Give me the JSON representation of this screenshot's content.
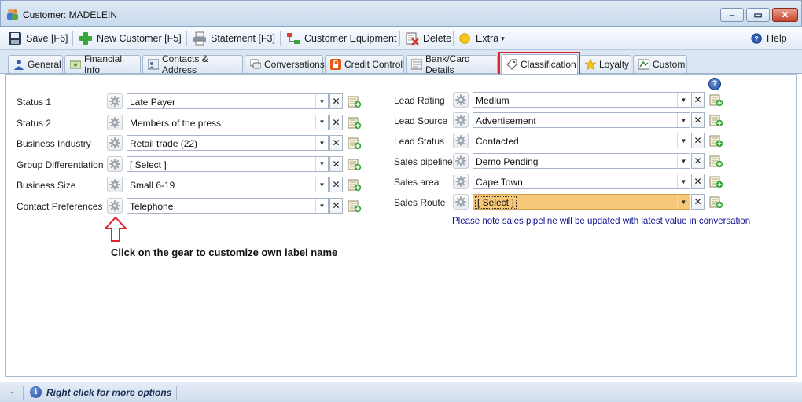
{
  "window": {
    "title": "Customer: MADELEIN",
    "minimize_glyph": "‒",
    "maximize_glyph": "▭",
    "close_glyph": "✕"
  },
  "toolbar": {
    "save_label": "Save [F6]",
    "new_customer_label": "New Customer [F5]",
    "statement_label": "Statement [F3]",
    "customer_equipment_label": "Customer Equipment",
    "delete_label": "Delete",
    "extra_label": "Extra",
    "extra_caret": "▾",
    "help_label": "Help"
  },
  "tabs": [
    {
      "label": "General",
      "icon": "person-icon"
    },
    {
      "label": "Financial Info",
      "icon": "money-icon"
    },
    {
      "label": "Contacts & Address",
      "icon": "contacts-icon"
    },
    {
      "label": "Conversations",
      "icon": "chat-icon"
    },
    {
      "label": "Credit Control",
      "icon": "lock-icon"
    },
    {
      "label": "Bank/Card Details",
      "icon": "card-icon"
    },
    {
      "label": "Classification",
      "icon": "tag-icon",
      "active": true
    },
    {
      "label": "Loyalty",
      "icon": "star-icon"
    },
    {
      "label": "Custom",
      "icon": "custom-icon"
    }
  ],
  "classification": {
    "left_fields": [
      {
        "label": "Status 1",
        "value": "Late Payer"
      },
      {
        "label": "Status 2",
        "value": "Members of the press"
      },
      {
        "label": "Business Industry",
        "value": "Retail trade (22)"
      },
      {
        "label": "Group Differentiation",
        "value": "[ Select ]"
      },
      {
        "label": "Business Size",
        "value": "Small 6-19"
      },
      {
        "label": "Contact Preferences",
        "value": "Telephone"
      }
    ],
    "right_fields": [
      {
        "label": "Lead Rating",
        "value": "Medium"
      },
      {
        "label": "Lead Source",
        "value": "Advertisement"
      },
      {
        "label": "Lead Status",
        "value": "Contacted"
      },
      {
        "label": "Sales pipeline",
        "value": "Demo Pending"
      },
      {
        "label": "Sales area",
        "value": "Cape Town"
      },
      {
        "label": "Sales Route",
        "value": "[ Select ]",
        "highlighted": true
      }
    ],
    "help_glyph": "?",
    "note": "Please note sales pipeline will be updated with latest value in conversation",
    "callout": "Click on the gear to customize own label name",
    "clear_glyph": "✕",
    "dropdown_glyph": "▼"
  },
  "statusbar": {
    "dash": "-",
    "info_glyph": "i",
    "message": "Right click for more options"
  },
  "colors": {
    "highlight_border": "#e0222b",
    "note_text": "#10138d",
    "selected_field": "#f7c879"
  }
}
